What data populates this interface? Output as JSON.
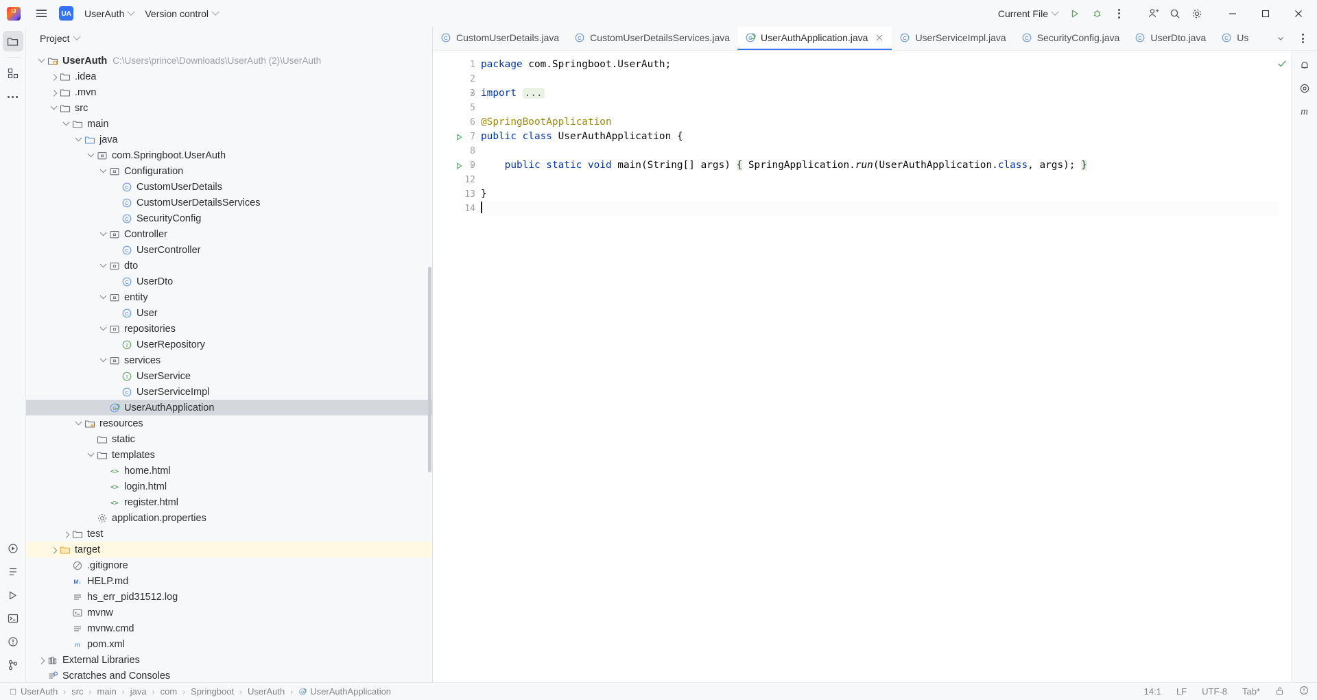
{
  "titlebar": {
    "logo_icon": "intellij-idea-logo",
    "menu_icon": "hamburger-menu-icon",
    "project_badge": "UA",
    "project_name": "UserAuth",
    "vcs_label": "Version control",
    "run_config": "Current File",
    "run_icon": "run-icon",
    "debug_icon": "debug-icon",
    "more_icon": "more-actions-icon",
    "account_icon": "account-icon",
    "search_icon": "search-icon",
    "settings_icon": "settings-gear-icon",
    "minimize_icon": "minimize-icon",
    "maximize_icon": "maximize-icon",
    "close_icon": "close-icon"
  },
  "left_stripe": {
    "top": [
      {
        "name": "project-tool-window",
        "icon": "folder-icon",
        "active": true
      },
      {
        "name": "commit-tool-window",
        "icon": "grid-icon",
        "active": false
      },
      {
        "name": "more-tool-windows",
        "icon": "ellipsis-icon",
        "active": false
      }
    ],
    "bottom": [
      {
        "name": "run-tool-window",
        "icon": "run-circle-icon"
      },
      {
        "name": "structure-tool-window",
        "icon": "structure-icon"
      },
      {
        "name": "services-tool-window",
        "icon": "play-icon"
      },
      {
        "name": "terminal-tool-window",
        "icon": "terminal-icon"
      },
      {
        "name": "problems-tool-window",
        "icon": "problems-icon"
      },
      {
        "name": "git-tool-window",
        "icon": "git-branch-icon"
      }
    ]
  },
  "project_panel": {
    "title": "Project",
    "tree": [
      {
        "depth": 0,
        "arrow": "open",
        "icon": "module-folder-icon",
        "label": "UserAuth",
        "bold": true,
        "sub": "C:\\Users\\prince\\Downloads\\UserAuth (2)\\UserAuth"
      },
      {
        "depth": 1,
        "arrow": "closed",
        "icon": "folder-icon",
        "label": ".idea"
      },
      {
        "depth": 1,
        "arrow": "closed",
        "icon": "folder-icon",
        "label": ".mvn"
      },
      {
        "depth": 1,
        "arrow": "open",
        "icon": "folder-icon",
        "label": "src"
      },
      {
        "depth": 2,
        "arrow": "open",
        "icon": "folder-icon",
        "label": "main"
      },
      {
        "depth": 3,
        "arrow": "open",
        "icon": "source-folder-icon",
        "label": "java"
      },
      {
        "depth": 4,
        "arrow": "open",
        "icon": "package-icon",
        "label": "com.Springboot.UserAuth"
      },
      {
        "depth": 5,
        "arrow": "open",
        "icon": "package-icon",
        "label": "Configuration"
      },
      {
        "depth": 6,
        "arrow": "none",
        "icon": "java-class-icon",
        "label": "CustomUserDetails"
      },
      {
        "depth": 6,
        "arrow": "none",
        "icon": "java-class-icon",
        "label": "CustomUserDetailsServices"
      },
      {
        "depth": 6,
        "arrow": "none",
        "icon": "java-class-icon",
        "label": "SecurityConfig"
      },
      {
        "depth": 5,
        "arrow": "open",
        "icon": "package-icon",
        "label": "Controller"
      },
      {
        "depth": 6,
        "arrow": "none",
        "icon": "java-class-icon",
        "label": "UserController"
      },
      {
        "depth": 5,
        "arrow": "open",
        "icon": "package-icon",
        "label": "dto"
      },
      {
        "depth": 6,
        "arrow": "none",
        "icon": "java-class-icon",
        "label": "UserDto"
      },
      {
        "depth": 5,
        "arrow": "open",
        "icon": "package-icon",
        "label": "entity"
      },
      {
        "depth": 6,
        "arrow": "none",
        "icon": "java-class-icon",
        "label": "User"
      },
      {
        "depth": 5,
        "arrow": "open",
        "icon": "package-icon",
        "label": "repositories"
      },
      {
        "depth": 6,
        "arrow": "none",
        "icon": "java-interface-icon",
        "label": "UserRepository"
      },
      {
        "depth": 5,
        "arrow": "open",
        "icon": "package-icon",
        "label": "services"
      },
      {
        "depth": 6,
        "arrow": "none",
        "icon": "java-interface-icon",
        "label": "UserService"
      },
      {
        "depth": 6,
        "arrow": "none",
        "icon": "java-class-icon",
        "label": "UserServiceImpl"
      },
      {
        "depth": 5,
        "arrow": "none",
        "icon": "spring-boot-class-icon",
        "label": "UserAuthApplication",
        "selected": true
      },
      {
        "depth": 3,
        "arrow": "open",
        "icon": "resources-folder-icon",
        "label": "resources"
      },
      {
        "depth": 4,
        "arrow": "none",
        "icon": "folder-icon",
        "label": "static"
      },
      {
        "depth": 4,
        "arrow": "open",
        "icon": "folder-icon",
        "label": "templates"
      },
      {
        "depth": 5,
        "arrow": "none",
        "icon": "html-file-icon",
        "label": "home.html"
      },
      {
        "depth": 5,
        "arrow": "none",
        "icon": "html-file-icon",
        "label": "login.html"
      },
      {
        "depth": 5,
        "arrow": "none",
        "icon": "html-file-icon",
        "label": "register.html"
      },
      {
        "depth": 4,
        "arrow": "none",
        "icon": "properties-file-icon",
        "label": "application.properties"
      },
      {
        "depth": 2,
        "arrow": "closed",
        "icon": "folder-icon",
        "label": "test"
      },
      {
        "depth": 1,
        "arrow": "closed",
        "icon": "excluded-folder-icon",
        "label": "target",
        "excluded": true
      },
      {
        "depth": 2,
        "arrow": "none",
        "icon": "gitignore-icon",
        "label": ".gitignore"
      },
      {
        "depth": 2,
        "arrow": "none",
        "icon": "markdown-icon",
        "label": "HELP.md"
      },
      {
        "depth": 2,
        "arrow": "none",
        "icon": "text-file-icon",
        "label": "hs_err_pid31512.log"
      },
      {
        "depth": 2,
        "arrow": "none",
        "icon": "shell-script-icon",
        "label": "mvnw"
      },
      {
        "depth": 2,
        "arrow": "none",
        "icon": "text-file-icon",
        "label": "mvnw.cmd"
      },
      {
        "depth": 2,
        "arrow": "none",
        "icon": "maven-icon",
        "label": "pom.xml"
      },
      {
        "depth": 0,
        "arrow": "closed",
        "icon": "library-icon",
        "label": "External Libraries"
      },
      {
        "depth": 0,
        "arrow": "none",
        "icon": "scratches-icon",
        "label": "Scratches and Consoles"
      }
    ]
  },
  "editor": {
    "tabs": [
      {
        "label": "CustomUserDetails.java",
        "icon": "java-class-icon",
        "active": false
      },
      {
        "label": "CustomUserDetailsServices.java",
        "icon": "java-class-icon",
        "active": false
      },
      {
        "label": "UserAuthApplication.java",
        "icon": "spring-boot-class-icon",
        "active": true,
        "closable": true
      },
      {
        "label": "UserServiceImpl.java",
        "icon": "java-class-icon",
        "active": false
      },
      {
        "label": "SecurityConfig.java",
        "icon": "java-class-icon",
        "active": false
      },
      {
        "label": "UserDto.java",
        "icon": "java-class-icon",
        "active": false
      },
      {
        "label": "Us",
        "icon": "java-class-icon",
        "active": false,
        "truncated": true
      }
    ],
    "tab_overflow_icon": "chevron-down-icon",
    "tab_options_icon": "more-options-icon",
    "line_numbers": [
      1,
      2,
      3,
      5,
      6,
      7,
      8,
      9,
      12,
      13,
      14
    ],
    "lines": [
      {
        "n": 1,
        "segments": [
          {
            "t": "package ",
            "c": "kw"
          },
          {
            "t": "com.Springboot.UserAuth;",
            "c": "txt"
          }
        ]
      },
      {
        "n": 2,
        "segments": []
      },
      {
        "n": 3,
        "segments": [
          {
            "t": "import ",
            "c": "kw"
          },
          {
            "t": "...",
            "c": "fold"
          }
        ],
        "fold": true
      },
      {
        "n": 5,
        "segments": []
      },
      {
        "n": 6,
        "segments": [
          {
            "t": "@SpringBootApplication",
            "c": "ann"
          }
        ]
      },
      {
        "n": 7,
        "segments": [
          {
            "t": "public class ",
            "c": "kw"
          },
          {
            "t": "UserAuthApplication {",
            "c": "txt"
          }
        ],
        "run": true
      },
      {
        "n": 8,
        "segments": []
      },
      {
        "n": 9,
        "segments": [
          {
            "t": "    ",
            "c": "txt"
          },
          {
            "t": "public static void ",
            "c": "kw"
          },
          {
            "t": "main",
            "c": "txt"
          },
          {
            "t": "(String[] args) ",
            "c": "txt"
          },
          {
            "t": "{",
            "c": "brace"
          },
          {
            "t": " SpringApplication.",
            "c": "txt"
          },
          {
            "t": "run",
            "c": "ital"
          },
          {
            "t": "(UserAuthApplication.",
            "c": "txt"
          },
          {
            "t": "class",
            "c": "kw"
          },
          {
            "t": ", args); ",
            "c": "txt"
          },
          {
            "t": "}",
            "c": "brace"
          }
        ],
        "run": true,
        "fold": true
      },
      {
        "n": 12,
        "segments": []
      },
      {
        "n": 13,
        "segments": [
          {
            "t": "}",
            "c": "txt"
          }
        ]
      },
      {
        "n": 14,
        "segments": [],
        "caret": true
      }
    ],
    "inspection_status_icon": "inspections-ok-icon",
    "right_icons": [
      "notifications-icon",
      "ai-assistant-icon",
      "maven-tool-icon"
    ]
  },
  "statusbar": {
    "breadcrumbs": [
      {
        "label": "UserAuth",
        "icon": "module-icon"
      },
      {
        "label": "src"
      },
      {
        "label": "main"
      },
      {
        "label": "java"
      },
      {
        "label": "com"
      },
      {
        "label": "Springboot"
      },
      {
        "label": "UserAuth"
      },
      {
        "label": "UserAuthApplication",
        "icon": "spring-boot-class-icon"
      }
    ],
    "caret_position": "14:1",
    "line_separator": "LF",
    "encoding": "UTF-8",
    "indent": "Tab*",
    "lock_icon": "unlocked-icon",
    "notification_icon": "notification-circle-icon"
  },
  "colors": {
    "accent": "#3574f0",
    "keyword": "#0033b3",
    "annotation": "#9e880d",
    "excluded_bg": "#fff8e3",
    "selection_bg": "#d4d7dc",
    "run_green": "#59a869"
  }
}
